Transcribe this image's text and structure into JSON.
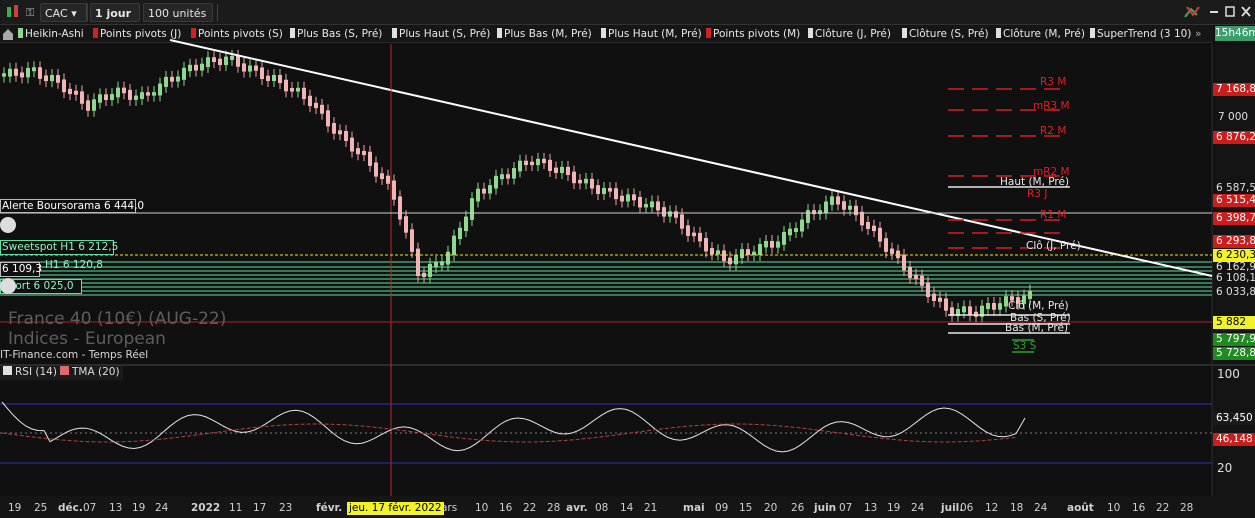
{
  "toolbar": {
    "symbol": "CAC",
    "period": "1 jour",
    "units": "100 unités"
  },
  "indicators": [
    {
      "label": "Heikin-Ashi",
      "color": "#8fd98f"
    },
    {
      "label": "Points pivots (J)",
      "color": "#d32020"
    },
    {
      "label": "Points pivots (S)",
      "color": "#d32020"
    },
    {
      "label": "Plus Bas (S, Pré)",
      "color": "#e0e0e0"
    },
    {
      "label": "Plus Haut (S, Pré)",
      "color": "#e0e0e0"
    },
    {
      "label": "Plus Bas (M, Pré)",
      "color": "#e0e0e0"
    },
    {
      "label": "Plus Haut (M, Pré)",
      "color": "#e0e0e0"
    },
    {
      "label": "Points pivots (M)",
      "color": "#d32020"
    },
    {
      "label": "Clôture (J, Pré)",
      "color": "#e0e0e0"
    },
    {
      "label": "Clôture (S, Pré)",
      "color": "#e0e0e0"
    },
    {
      "label": "Clôture (M, Pré)",
      "color": "#e0e0e0"
    },
    {
      "label": "SuperTrend (3 10)",
      "color": "#e0e0e0"
    }
  ],
  "time_label": "15h46m",
  "price_axis": {
    "ticks": [
      "7 000",
      "6 587,5",
      "6 162,9",
      "6 108,1",
      "6 033,8"
    ],
    "boxes": [
      {
        "text": "7 168,8",
        "color": "#c81e1e",
        "text_color": "#ffffff"
      },
      {
        "text": "6 876,2",
        "color": "#c81e1e",
        "text_color": "#ffffff"
      },
      {
        "text": "6 515,4",
        "color": "#c81e1e",
        "text_color": "#ffffff"
      },
      {
        "text": "6 398,7",
        "color": "#c81e1e",
        "text_color": "#ffffff"
      },
      {
        "text": "6 293,8",
        "color": "#c81e1e",
        "text_color": "#ffffff"
      },
      {
        "text": "6 230,3",
        "color": "#f2f22a",
        "text_color": "#000000"
      },
      {
        "text": "5 882",
        "color": "#f2f22a",
        "text_color": "#000000"
      },
      {
        "text": "5 797,9",
        "color": "#1f8a1f",
        "text_color": "#ffffff"
      },
      {
        "text": "5 728,8",
        "color": "#1f8a1f",
        "text_color": "#ffffff"
      }
    ]
  },
  "chart_labels": [
    {
      "text": "R3 M",
      "color": "#e02020"
    },
    {
      "text": "mR3 M",
      "color": "#e02020"
    },
    {
      "text": "R2 M",
      "color": "#e02020"
    },
    {
      "text": "mR2 M",
      "color": "#e02020"
    },
    {
      "text": "Haut (M, Pré)",
      "color": "#e8e8e8"
    },
    {
      "text": "R3 J",
      "color": "#e02020"
    },
    {
      "text": "R1 M",
      "color": "#e02020"
    },
    {
      "text": "Clô (J, Pré)",
      "color": "#e8e8e8"
    },
    {
      "text": "Clô (M, Pré)",
      "color": "#e8e8e8"
    },
    {
      "text": "Bas (S, Pré)",
      "color": "#e8e8e8"
    },
    {
      "text": "Bas (M, Pré)",
      "color": "#e8e8e8"
    },
    {
      "text": "S3 S",
      "color": "#2fa02f"
    }
  ],
  "alerts": [
    {
      "text": "Alerte Boursorama 6 444,0",
      "color": "#ffffff"
    },
    {
      "text": "Sweetspot H1 6 212,5",
      "color": "#8ff0c0"
    },
    {
      "text": "6 109,3",
      "color": "#ffffff"
    },
    {
      "text": "H1 6 120,8",
      "color": "#8ff0c0"
    },
    {
      "text": "pport 6 025,0",
      "color": "#8ff0c0"
    }
  ],
  "watermark": {
    "line1": "France 40 (10€) (AUG-22)",
    "line2": "Indices - European",
    "line3": "IT-Finance.com - Temps Réel"
  },
  "rsi_panel": {
    "indicators": [
      {
        "label": "RSI (14)",
        "color": "#e0e0e0"
      },
      {
        "label": "TMA (20)",
        "color": "#e06a6a"
      }
    ],
    "ticks": [
      "100",
      "20"
    ],
    "boxes": [
      {
        "text": "63,450",
        "color": "#1a1a1a",
        "text_color": "#ffffff"
      },
      {
        "text": "46,148",
        "color": "#c81e1e",
        "text_color": "#ffffff"
      }
    ]
  },
  "x_axis": {
    "labels": [
      "19",
      "25",
      "déc.",
      "07",
      "13",
      "19",
      "24",
      "2022",
      "11",
      "17",
      "23",
      "févr.",
      "ars",
      "10",
      "16",
      "22",
      "28",
      "avr.",
      "08",
      "14",
      "21",
      "mai",
      "09",
      "15",
      "20",
      "26",
      "juin",
      "07",
      "13",
      "19",
      "24",
      "juil.",
      "06",
      "12",
      "18",
      "24",
      "août",
      "10",
      "16",
      "22",
      "28"
    ],
    "crosshair_label": "jeu. 17 févr. 2022"
  },
  "chart_data": {
    "type": "line",
    "title": "France 40 (10€) (AUG-22)",
    "series": [
      {
        "name": "Heikin-Ashi",
        "values": [
          7100,
          7120,
          7060,
          6950,
          7020,
          6990,
          7080,
          7150,
          7180,
          7120,
          7060,
          6980,
          6820,
          6700,
          6540,
          6120,
          6230,
          6520,
          6610,
          6690,
          6640,
          6570,
          6520,
          6480,
          6430,
          6300,
          6200,
          6250,
          6300,
          6420,
          6500,
          6390,
          6240,
          6090,
          5960,
          5950,
          6000,
          6030
        ]
      }
    ],
    "ylim": [
      5700,
      7250
    ]
  }
}
